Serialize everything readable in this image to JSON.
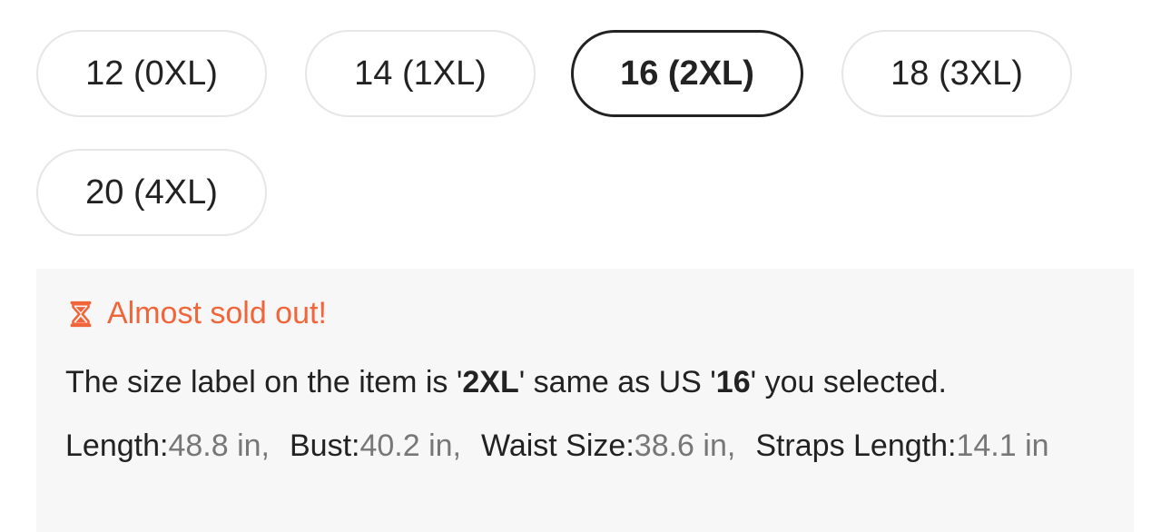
{
  "sizes": [
    {
      "label": "12 (0XL)",
      "selected": false
    },
    {
      "label": "14 (1XL)",
      "selected": false
    },
    {
      "label": "16 (2XL)",
      "selected": true
    },
    {
      "label": "18 (3XL)",
      "selected": false
    },
    {
      "label": "20 (4XL)",
      "selected": false
    }
  ],
  "stock_alert": {
    "icon": "hourglass-icon",
    "text": "Almost sold out!",
    "color": "#f0663a"
  },
  "size_note": {
    "prefix": "The size label on the item is '",
    "label": "2XL",
    "middle": "' same as US '",
    "us_size": "16",
    "suffix": "' you selected."
  },
  "measurements": [
    {
      "name": "Length:",
      "value": "48.8 in,"
    },
    {
      "name": "Bust:",
      "value": "40.2 in,"
    },
    {
      "name": "Waist Size:",
      "value": "38.6 in,"
    },
    {
      "name": "Straps Length:",
      "value": "14.1 in"
    }
  ]
}
